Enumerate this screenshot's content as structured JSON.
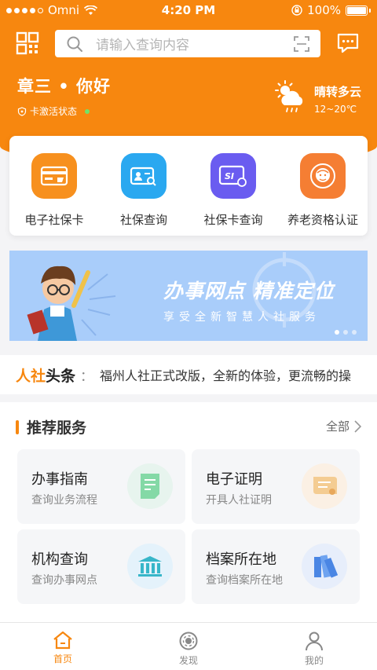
{
  "status_bar": {
    "carrier": "Omni",
    "time": "4:20 PM",
    "battery": "100%"
  },
  "search": {
    "placeholder": "请输入查询内容"
  },
  "user": {
    "greeting": "章三 • 你好",
    "card_status": "卡激活状态"
  },
  "weather": {
    "condition": "晴转多云",
    "temp": "12~20℃"
  },
  "quick_menu": [
    {
      "label": "电子社保卡",
      "icon": "card-icon",
      "color": "#f7901e"
    },
    {
      "label": "社保查询",
      "icon": "id-search-icon",
      "color": "#2aa8f0"
    },
    {
      "label": "社保卡查询",
      "icon": "si-card-icon",
      "color": "#6a5cf0"
    },
    {
      "label": "养老资格认证",
      "icon": "elder-icon",
      "color": "#f57e33"
    }
  ],
  "banner": {
    "title": "办事网点 精准定位",
    "subtitle": "享受全新智慧人社服务",
    "page_count": 3,
    "active_page": 1
  },
  "news": {
    "brand_a": "人社",
    "brand_b": "头条",
    "text": "福州人社正式改版，全新的体验，更流畅的操作"
  },
  "recommend": {
    "title": "推荐服务",
    "all_label": "全部",
    "items": [
      {
        "title": "办事指南",
        "subtitle": "查询业务流程",
        "icon": "guide-doc-icon"
      },
      {
        "title": "电子证明",
        "subtitle": "开具人社证明",
        "icon": "certificate-icon"
      },
      {
        "title": "机构查询",
        "subtitle": "查询办事网点",
        "icon": "institution-icon"
      },
      {
        "title": "档案所在地",
        "subtitle": "查询档案所在地",
        "icon": "archive-icon"
      }
    ]
  },
  "tabbar": [
    {
      "label": "首页",
      "icon": "home-icon",
      "active": true
    },
    {
      "label": "发现",
      "icon": "discover-icon",
      "active": false
    },
    {
      "label": "我的",
      "icon": "profile-icon",
      "active": false
    }
  ],
  "colors": {
    "accent": "#f7870f",
    "banner_bg": "#a9cdfa"
  }
}
